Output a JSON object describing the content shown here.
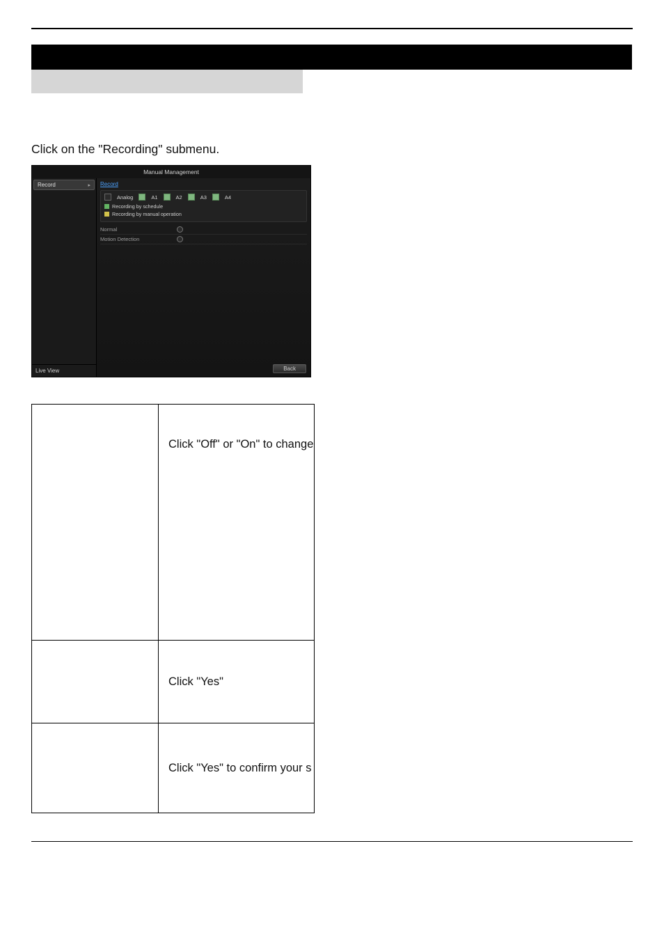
{
  "instruction_line": "Click on the \"Recording\" submenu.",
  "screenshot": {
    "window_title": "Manual Management",
    "sidebar": {
      "active_item": "Record",
      "bottom_item": "Live View"
    },
    "tab_label": "Record",
    "channels": {
      "group_label": "Analog",
      "items": [
        "A1",
        "A2",
        "A3",
        "A4"
      ]
    },
    "legend": {
      "schedule": "Recording by schedule",
      "manual": "Recording by manual operation"
    },
    "mode_rows": {
      "normal": "Normal",
      "motion": "Motion Detection"
    },
    "back_button": "Back"
  },
  "table": {
    "row1_text": "Click \"Off\" or \"On\" to change",
    "row2_text": "Click \"Yes\"",
    "row3_text": "Click \"Yes\" to confirm your s"
  }
}
